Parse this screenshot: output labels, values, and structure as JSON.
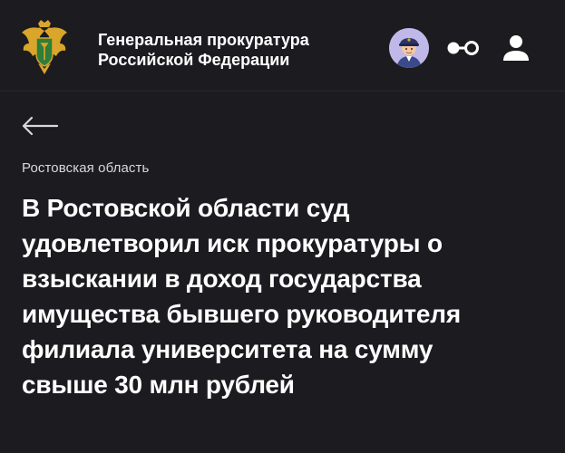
{
  "header": {
    "org_name_line1": "Генеральная прокуратура",
    "org_name_line2": "Российской Федерации",
    "logo_icon": "prosecutor-emblem-icon",
    "helper_avatar_icon": "assistant-avatar-icon",
    "accessibility_icon": "glasses-icon",
    "profile_icon": "user-icon"
  },
  "navigation": {
    "back_icon": "arrow-left-icon"
  },
  "article": {
    "region": "Ростовская область",
    "title_lines": [
      "В Ростовской области суд",
      "удовлетворил иск прокуратуры о",
      "взыскании в доход государства",
      "имущества бывшего руководителя",
      "филиала университета на сумму",
      "свыше 30 млн рублей"
    ]
  },
  "colors": {
    "background": "#1c1b1f",
    "text": "#ffffff",
    "muted_text": "#d8d8dc",
    "avatar_bg": "#bfb8e8",
    "emblem_gold": "#d9a62b",
    "emblem_green": "#2e7d3a"
  }
}
